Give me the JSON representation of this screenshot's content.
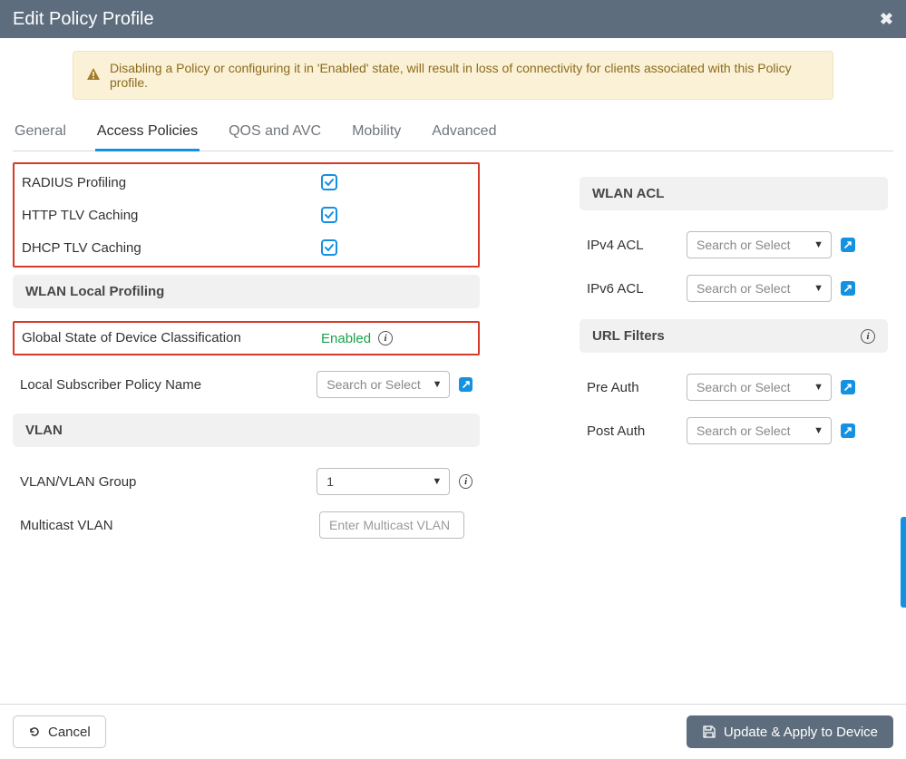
{
  "header": {
    "title": "Edit Policy Profile"
  },
  "alert": {
    "text": "Disabling a Policy or configuring it in 'Enabled' state, will result in loss of connectivity for clients associated with this Policy profile."
  },
  "tabs": {
    "items": [
      {
        "label": "General"
      },
      {
        "label": "Access Policies"
      },
      {
        "label": "QOS and AVC"
      },
      {
        "label": "Mobility"
      },
      {
        "label": "Advanced"
      }
    ],
    "active_index": 1
  },
  "left": {
    "profiling": {
      "radius_label": "RADIUS Profiling",
      "http_tlv_label": "HTTP TLV Caching",
      "dhcp_tlv_label": "DHCP TLV Caching",
      "radius_checked": true,
      "http_tlv_checked": true,
      "dhcp_tlv_checked": true
    },
    "wlan_local_profiling": {
      "header": "WLAN Local Profiling",
      "global_state_label": "Global State of Device Classification",
      "global_state_value": "Enabled",
      "local_subscriber_label": "Local Subscriber Policy Name",
      "local_subscriber_placeholder": "Search or Select"
    },
    "vlan": {
      "header": "VLAN",
      "group_label": "VLAN/VLAN Group",
      "group_value": "1",
      "multicast_label": "Multicast VLAN",
      "multicast_placeholder": "Enter Multicast VLAN",
      "multicast_value": ""
    }
  },
  "right": {
    "wlan_acl": {
      "header": "WLAN ACL",
      "ipv4_label": "IPv4 ACL",
      "ipv4_placeholder": "Search or Select",
      "ipv6_label": "IPv6 ACL",
      "ipv6_placeholder": "Search or Select"
    },
    "url_filters": {
      "header": "URL Filters",
      "pre_auth_label": "Pre Auth",
      "pre_auth_placeholder": "Search or Select",
      "post_auth_label": "Post Auth",
      "post_auth_placeholder": "Search or Select"
    }
  },
  "footer": {
    "cancel_label": "Cancel",
    "apply_label": "Update & Apply to Device"
  }
}
